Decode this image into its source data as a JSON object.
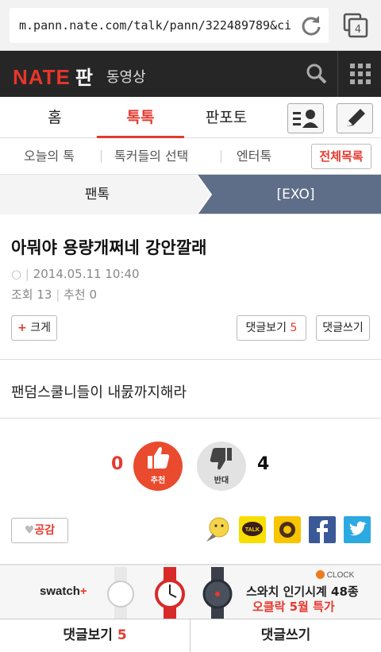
{
  "browser": {
    "url": "m.pann.nate.com/talk/pann/322489789&ci",
    "tab_count": "4"
  },
  "header": {
    "logo": "NATE",
    "logo_sub": "판",
    "video_label": "동영상"
  },
  "main_nav": {
    "items": [
      "홈",
      "톡톡",
      "판포토"
    ],
    "active": "톡톡"
  },
  "sub_nav": {
    "items": [
      "오늘의 톡",
      "톡커들의 선택",
      "엔터톡"
    ],
    "all_list": "전체목록"
  },
  "breadcrumb": {
    "first": "팬톡",
    "second": "[EXO]"
  },
  "post": {
    "title": "아뭐야 용량개쩌네 강안깔래",
    "date": "2014.05.11 10:40",
    "views_label": "조회",
    "views": "13",
    "recommend_label": "추천",
    "recommend": "0",
    "content": "팬덤스쿨니들이 내뭀까지해라"
  },
  "buttons": {
    "zoom": "크게",
    "comments_view": "댓글보기",
    "comment_count": "5",
    "comment_write": "댓글쓰기"
  },
  "votes": {
    "up_count": "0",
    "up_label": "추천",
    "down_count": "4",
    "down_label": "반대"
  },
  "empathy": "공감",
  "ad": {
    "brand": "swatch",
    "line1": "스와치 인기시계 48종",
    "line2": "오클락 5월 특가",
    "badge": "CLOCK"
  },
  "footer": {
    "view": "댓글보기",
    "count": "5",
    "write": "댓글쓰기"
  },
  "colors": {
    "accent": "#e53a2f",
    "dark": "#262626",
    "breadcrumb": "#5e6e89"
  }
}
